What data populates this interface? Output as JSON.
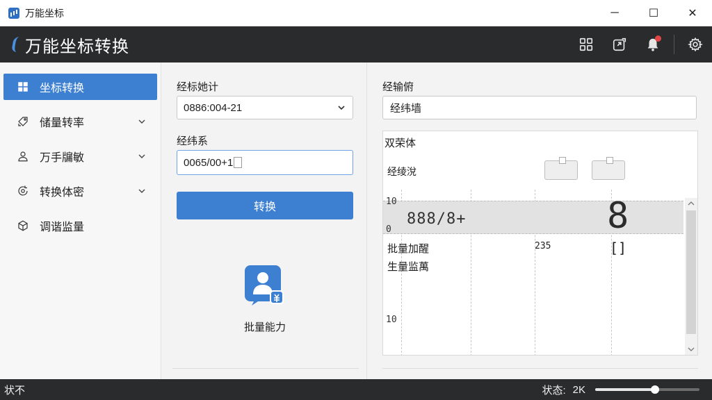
{
  "window": {
    "title": "万能坐标"
  },
  "window_controls": {
    "minimize": "─",
    "maximize": "☐",
    "close": "✕"
  },
  "header": {
    "app_title": "万能坐标转换",
    "tools": [
      "grid-icon",
      "export-icon",
      "bell-icon",
      "gear-icon"
    ]
  },
  "sidebar": {
    "items": [
      {
        "label": "坐标转换",
        "icon": "grid-icon",
        "active": true,
        "expandable": false
      },
      {
        "label": "储量转率",
        "icon": "tag-icon",
        "active": false,
        "expandable": true
      },
      {
        "label": "万手牖敏",
        "icon": "user-icon",
        "active": false,
        "expandable": true
      },
      {
        "label": "转换体密",
        "icon": "refresh-gear-icon",
        "active": false,
        "expandable": true
      },
      {
        "label": "调谐监量",
        "icon": "cube-icon",
        "active": false,
        "expandable": false
      }
    ]
  },
  "form": {
    "label1": "经标她计",
    "select1_value": "0886:004-21",
    "label2": "经纬系",
    "input2_value": "0065/00+1",
    "convert_button": "转换",
    "batch_label": "批量能力"
  },
  "output": {
    "label": "经输俯",
    "input_value": "经纬墙",
    "panel": {
      "title": "双荣体",
      "subtitle": "经绫涗",
      "tick_top": "10",
      "tick_mid": "0",
      "tick_bottom": "10",
      "seg_text": "888/8+",
      "big_seg": "8",
      "row1_label": "批量加醒",
      "row1_value": "235",
      "row1_bracket": "[]",
      "row2_label": "生量监萬"
    }
  },
  "status": {
    "left": "状不",
    "right_label": "状态:",
    "right_value": "2K",
    "slider_fraction": 0.57
  },
  "colors": {
    "accent": "#3d7fd1",
    "dark_bar": "#2a2b2d",
    "notify": "#e14545"
  }
}
